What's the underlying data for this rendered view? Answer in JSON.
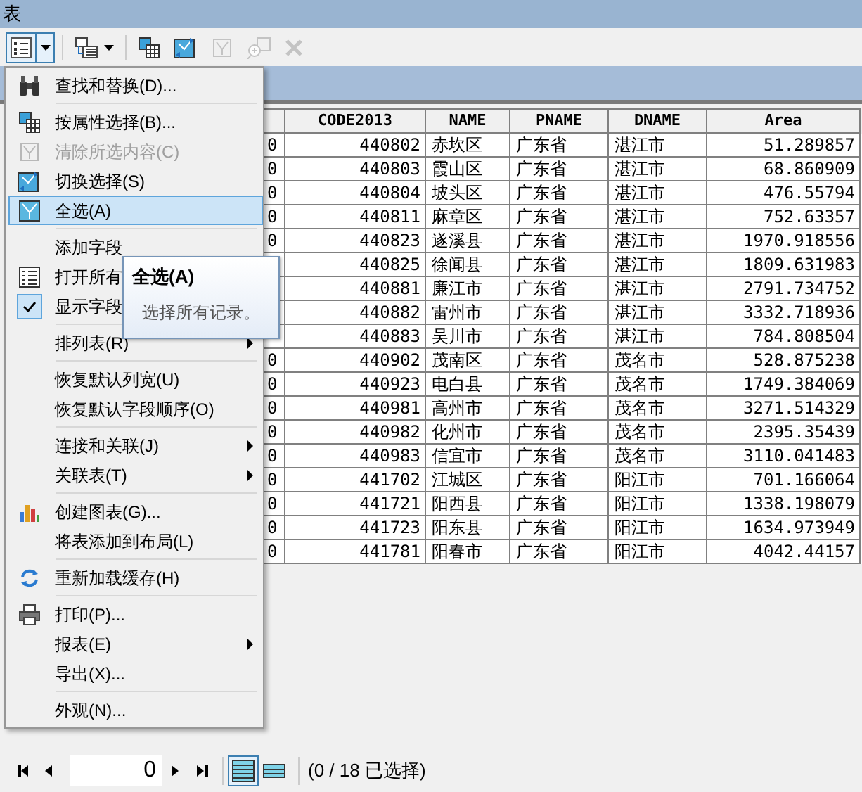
{
  "window": {
    "title": "表"
  },
  "toolbar": [
    {
      "kind": "options",
      "pressed": true,
      "disabled": false
    },
    {
      "kind": "related",
      "pressed": false,
      "disabled": false
    },
    {
      "kind": "select-by-attr",
      "pressed": false,
      "disabled": false
    },
    {
      "kind": "switch",
      "pressed": false,
      "disabled": false
    },
    {
      "kind": "clear",
      "pressed": false,
      "disabled": true
    },
    {
      "kind": "zoom",
      "pressed": false,
      "disabled": true
    },
    {
      "kind": "delete",
      "pressed": false,
      "disabled": true
    }
  ],
  "menu": [
    {
      "kind": "item",
      "label": "查找和替换(D)...",
      "disabled": false,
      "selected": false,
      "submenu": false
    },
    {
      "kind": "separator"
    },
    {
      "kind": "item",
      "label": "按属性选择(B)...",
      "disabled": false,
      "selected": false,
      "submenu": false
    },
    {
      "kind": "item",
      "label": "清除所选内容(C)",
      "disabled": true,
      "selected": false,
      "submenu": false
    },
    {
      "kind": "item",
      "label": "切换选择(S)",
      "disabled": false,
      "selected": false,
      "submenu": false
    },
    {
      "kind": "item",
      "label": "全选(A)",
      "disabled": false,
      "selected": true,
      "submenu": false
    },
    {
      "kind": "separator"
    },
    {
      "kind": "item",
      "label": "添加字段",
      "disabled": false,
      "selected": false,
      "submenu": false
    },
    {
      "kind": "item",
      "label": "打开所有",
      "disabled": false,
      "selected": false,
      "submenu": false
    },
    {
      "kind": "check",
      "label": "显示字段",
      "checked": true,
      "disabled": false,
      "selected": false,
      "submenu": false
    },
    {
      "kind": "separator"
    },
    {
      "kind": "item",
      "label": "排列表(R)",
      "disabled": false,
      "selected": false,
      "submenu": true
    },
    {
      "kind": "separator"
    },
    {
      "kind": "item",
      "label": "恢复默认列宽(U)",
      "disabled": false,
      "selected": false,
      "submenu": false
    },
    {
      "kind": "item",
      "label": "恢复默认字段顺序(O)",
      "disabled": false,
      "selected": false,
      "submenu": false
    },
    {
      "kind": "separator"
    },
    {
      "kind": "item",
      "label": "连接和关联(J)",
      "disabled": false,
      "selected": false,
      "submenu": true
    },
    {
      "kind": "item",
      "label": "关联表(T)",
      "disabled": false,
      "selected": false,
      "submenu": true
    },
    {
      "kind": "separator"
    },
    {
      "kind": "item",
      "label": "创建图表(G)...",
      "disabled": false,
      "selected": false,
      "submenu": false
    },
    {
      "kind": "item",
      "label": "将表添加到布局(L)",
      "disabled": false,
      "selected": false,
      "submenu": false
    },
    {
      "kind": "separator"
    },
    {
      "kind": "item",
      "label": "重新加载缓存(H)",
      "disabled": false,
      "selected": false,
      "submenu": false
    },
    {
      "kind": "separator"
    },
    {
      "kind": "item",
      "label": "打印(P)...",
      "disabled": false,
      "selected": false,
      "submenu": false
    },
    {
      "kind": "item",
      "label": "报表(E)",
      "disabled": false,
      "selected": false,
      "submenu": true
    },
    {
      "kind": "item",
      "label": "导出(X)...",
      "disabled": false,
      "selected": false,
      "submenu": false
    },
    {
      "kind": "separator"
    },
    {
      "kind": "item",
      "label": "外观(N)...",
      "disabled": false,
      "selected": false,
      "submenu": false
    }
  ],
  "tooltip": {
    "title": "全选(A)",
    "text": "选择所有记录。"
  },
  "table": {
    "columns": [
      "CODE2013",
      "NAME",
      "PNAME",
      "DNAME",
      "Area"
    ],
    "rows": [
      {
        "column_1": "0",
        "cells": [
          "440802",
          "赤坎区",
          "广东省",
          "湛江市",
          "51.289857"
        ]
      },
      {
        "column_1": "0",
        "cells": [
          "440803",
          "霞山区",
          "广东省",
          "湛江市",
          "68.860909"
        ]
      },
      {
        "column_1": "0",
        "cells": [
          "440804",
          "坡头区",
          "广东省",
          "湛江市",
          "476.55794"
        ]
      },
      {
        "column_1": "0",
        "cells": [
          "440811",
          "麻章区",
          "广东省",
          "湛江市",
          "752.63357"
        ]
      },
      {
        "column_1": "0",
        "cells": [
          "440823",
          "遂溪县",
          "广东省",
          "湛江市",
          "1970.918556"
        ]
      },
      {
        "cells": [
          "440825",
          "徐闻县",
          "广东省",
          "湛江市",
          "1809.631983"
        ]
      },
      {
        "cells": [
          "440881",
          "廉江市",
          "广东省",
          "湛江市",
          "2791.734752"
        ]
      },
      {
        "cells": [
          "440882",
          "雷州市",
          "广东省",
          "湛江市",
          "3332.718936"
        ]
      },
      {
        "cells": [
          "440883",
          "吴川市",
          "广东省",
          "湛江市",
          "784.808504"
        ]
      },
      {
        "column_1": "0",
        "cells": [
          "440902",
          "茂南区",
          "广东省",
          "茂名市",
          "528.875238"
        ]
      },
      {
        "column_1": "0",
        "cells": [
          "440923",
          "电白县",
          "广东省",
          "茂名市",
          "1749.384069"
        ]
      },
      {
        "column_1": "0",
        "cells": [
          "440981",
          "高州市",
          "广东省",
          "茂名市",
          "3271.514329"
        ]
      },
      {
        "column_1": "0",
        "cells": [
          "440982",
          "化州市",
          "广东省",
          "茂名市",
          "2395.35439"
        ]
      },
      {
        "column_1": "0",
        "cells": [
          "440983",
          "信宜市",
          "广东省",
          "茂名市",
          "3110.041483"
        ]
      },
      {
        "column_1": "0",
        "cells": [
          "441702",
          "江城区",
          "广东省",
          "阳江市",
          "701.166064"
        ]
      },
      {
        "column_1": "0",
        "cells": [
          "441721",
          "阳西县",
          "广东省",
          "阳江市",
          "1338.198079"
        ]
      },
      {
        "column_1": "0",
        "cells": [
          "441723",
          "阳东县",
          "广东省",
          "阳江市",
          "1634.973949"
        ]
      },
      {
        "column_1": "0",
        "cells": [
          "441781",
          "阳春市",
          "广东省",
          "阳江市",
          "4042.44157"
        ]
      }
    ]
  },
  "status_bar": {
    "record": "0",
    "views": [
      {
        "selected": true
      },
      {
        "selected": false
      }
    ],
    "selection": "(0 / 18 已选择)"
  }
}
